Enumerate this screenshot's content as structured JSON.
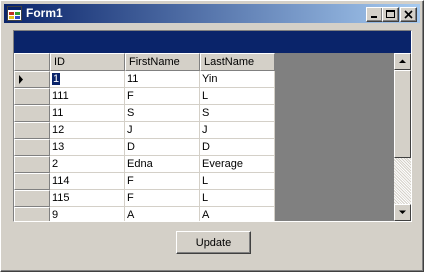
{
  "window": {
    "title": "Form1"
  },
  "grid": {
    "columns": [
      "ID",
      "FirstName",
      "LastName"
    ],
    "rows": [
      [
        "1",
        "11",
        "Yin"
      ],
      [
        "111",
        "F",
        "L"
      ],
      [
        "11",
        "S",
        "S"
      ],
      [
        "12",
        "J",
        "J"
      ],
      [
        "13",
        "D",
        "D"
      ],
      [
        "2",
        "Edna",
        "Everage"
      ],
      [
        "114",
        "F",
        "L"
      ],
      [
        "115",
        "F",
        "L"
      ],
      [
        "9",
        "A",
        "A"
      ]
    ],
    "current_row": 0
  },
  "actions": {
    "update_label": "Update"
  }
}
